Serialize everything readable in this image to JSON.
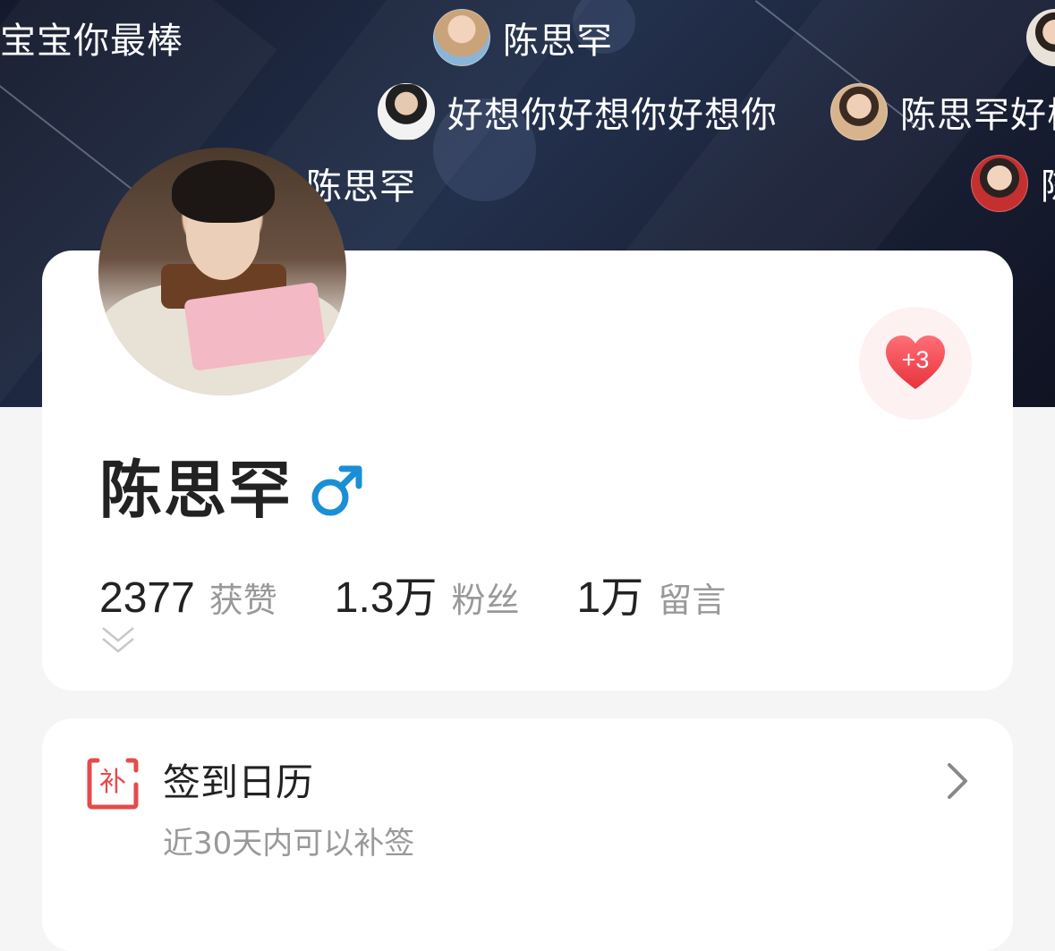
{
  "danmu": [
    {
      "text": "宝宝你最棒",
      "avatar": false
    },
    {
      "text": "陈思罕",
      "avatar": true
    },
    {
      "text": "好想你好想你好想你",
      "avatar": true
    },
    {
      "text": "陈思罕好棒",
      "avatar": true
    },
    {
      "text": "陈思罕",
      "avatar": false
    },
    {
      "text": "陈",
      "avatar": true
    },
    {
      "text": "",
      "avatar": true
    }
  ],
  "profile": {
    "name": "陈思罕",
    "gender_icon": "male-symbol-icon",
    "like_count": "+3",
    "stats": [
      {
        "value": "2377",
        "label": "获赞"
      },
      {
        "value": "1.3万",
        "label": "粉丝"
      },
      {
        "value": "1万",
        "label": "留言"
      }
    ]
  },
  "calendar": {
    "icon_char": "补",
    "title": "签到日历",
    "subtitle": "近30天内可以补签"
  },
  "colors": {
    "banner": "#1c2438",
    "heart": "#f0505a",
    "male": "#1a8fd6",
    "calendar_icon": "#e54b4b"
  }
}
